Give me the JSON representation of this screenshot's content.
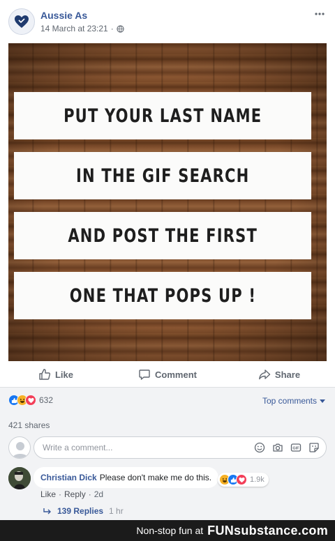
{
  "post": {
    "page_name": "Aussie As",
    "timestamp": "14 March at 23:21",
    "separator": "·",
    "privacy_icon": "globe-icon",
    "avatar_icon": "heart-icon",
    "more_icon": "more-options-icon",
    "image_lines": [
      "PUT YOUR LAST NAME",
      "IN THE GIF SEARCH",
      "AND POST THE FIRST",
      "ONE THAT POPS UP !"
    ]
  },
  "actions": {
    "like": "Like",
    "comment": "Comment",
    "share": "Share"
  },
  "engagement": {
    "reaction_icons": [
      "like-reaction-icon",
      "haha-reaction-icon",
      "love-reaction-icon"
    ],
    "reaction_count": "632",
    "top_comments": "Top comments",
    "shares": "421 shares"
  },
  "composer": {
    "placeholder": "Write a comment...",
    "icons": [
      "emoji-icon",
      "camera-icon",
      "gif-icon",
      "sticker-icon"
    ]
  },
  "comment": {
    "author": "Christian Dick",
    "text": "Please don't make me do this.",
    "reaction_count": "1.9k",
    "like": "Like",
    "reply": "Reply",
    "age": "2d",
    "dot": "·",
    "replies": "139 Replies",
    "replies_age": "1 hr"
  },
  "footer": {
    "tagline": "Non-stop fun at",
    "logo": "FUNsubstance.com"
  },
  "colors": {
    "link_blue": "#385898",
    "like_blue": "#1877f2",
    "love_red": "#f33e58",
    "haha_yellow": "#f7b125"
  }
}
